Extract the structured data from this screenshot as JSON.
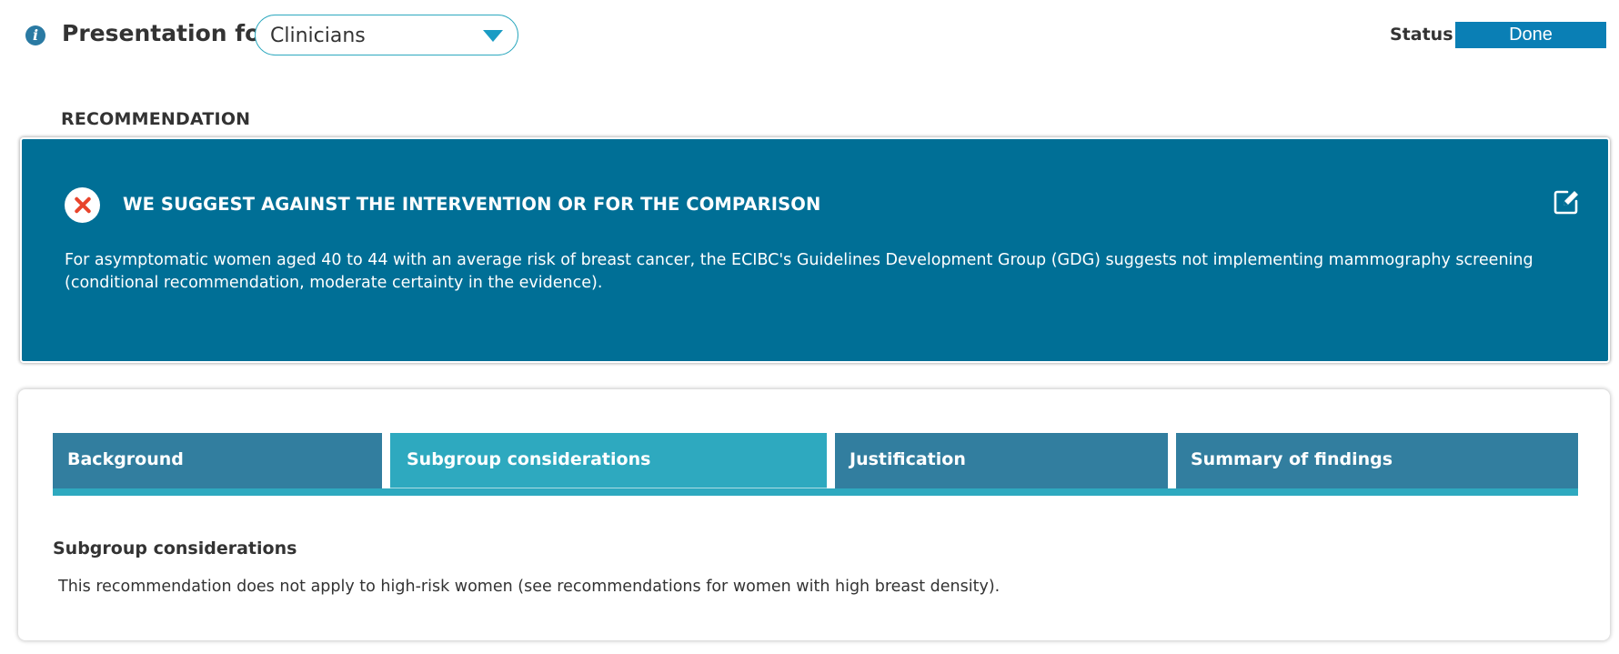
{
  "header": {
    "presentation_label": "Presentation for",
    "audience_select": {
      "value": "Clinicians"
    },
    "status_label": "Status",
    "status_value": "Done"
  },
  "recommendation": {
    "section_heading": "RECOMMENDATION",
    "title": "WE SUGGEST AGAINST THE INTERVENTION OR FOR THE COMPARISON",
    "text": "For asymptomatic women aged 40 to 44 with an average risk of breast cancer, the ECIBC's Guidelines Development Group (GDG) suggests not implementing mammography screening (conditional recommendation, moderate certainty in the evidence).",
    "icon": "close-icon",
    "edit_icon": "edit-icon"
  },
  "tabs": [
    {
      "label": "Background",
      "active": false
    },
    {
      "label": "Subgroup considerations",
      "active": true
    },
    {
      "label": "Justification",
      "active": false
    },
    {
      "label": "Summary of findings",
      "active": false
    }
  ],
  "content": {
    "heading": "Subgroup considerations",
    "text": "This recommendation does not apply to high-risk women (see recommendations for women with high breast density)."
  },
  "colors": {
    "recommendation_bg": "#006f96",
    "tab_bg": "#327e9f",
    "tab_active_bg": "#2ea9bf",
    "status_button_bg": "#0a7fb5",
    "reject_icon": "#e8442c"
  }
}
